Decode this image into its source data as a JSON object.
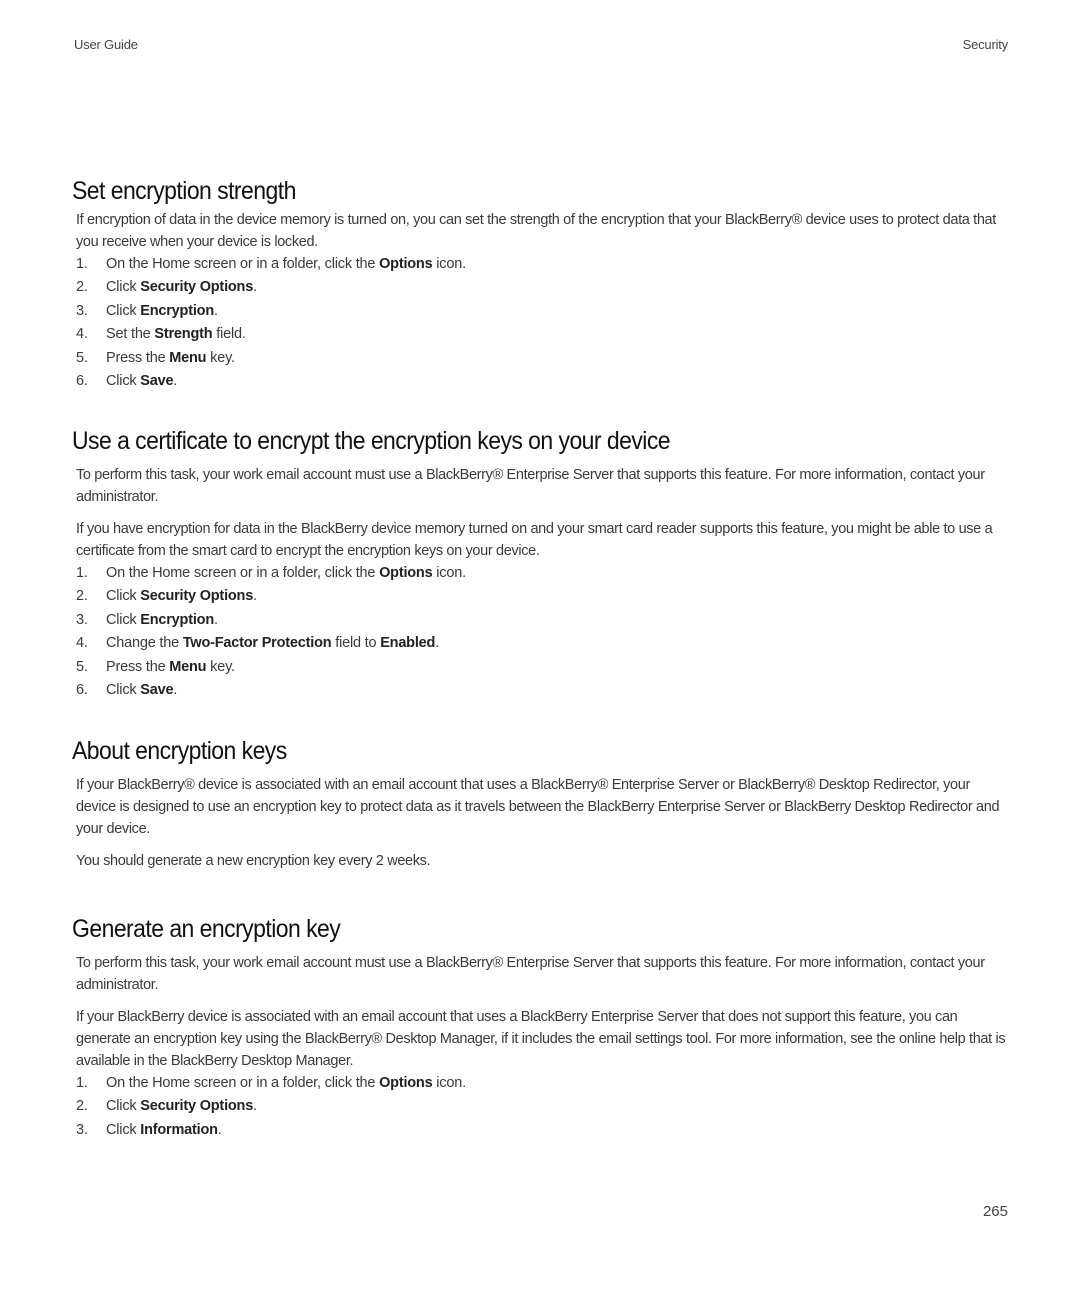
{
  "header": {
    "left": "User Guide",
    "right": "Security"
  },
  "sections": [
    {
      "title": "Set encryption strength",
      "paragraphs": [
        "If encryption of data in the device memory is turned on, you can set the strength of the encryption that your BlackBerry® device uses to protect data that you receive when your device is locked."
      ],
      "steps": [
        {
          "num": "1.",
          "parts": [
            [
              "t",
              "On the Home screen or in a folder, click the "
            ],
            [
              "b",
              "Options"
            ],
            [
              "t",
              " icon."
            ]
          ]
        },
        {
          "num": "2.",
          "parts": [
            [
              "t",
              "Click "
            ],
            [
              "b",
              "Security Options"
            ],
            [
              "t",
              "."
            ]
          ]
        },
        {
          "num": "3.",
          "parts": [
            [
              "t",
              "Click "
            ],
            [
              "b",
              "Encryption"
            ],
            [
              "t",
              "."
            ]
          ]
        },
        {
          "num": "4.",
          "parts": [
            [
              "t",
              "Set the "
            ],
            [
              "b",
              "Strength"
            ],
            [
              "t",
              " field."
            ]
          ]
        },
        {
          "num": "5.",
          "parts": [
            [
              "t",
              "Press the "
            ],
            [
              "b",
              "Menu"
            ],
            [
              "t",
              " key."
            ]
          ]
        },
        {
          "num": "6.",
          "parts": [
            [
              "t",
              "Click "
            ],
            [
              "b",
              "Save"
            ],
            [
              "t",
              "."
            ]
          ]
        }
      ]
    },
    {
      "title": "Use a certificate to encrypt the encryption keys on your device",
      "paragraphs": [
        "To perform this task, your work email account must use a BlackBerry® Enterprise Server that supports this feature. For more information, contact your administrator.",
        "If you have encryption for data in the BlackBerry device memory turned on and your smart card reader supports this feature, you might be able to use a certificate from the smart card to encrypt the encryption keys on your device."
      ],
      "steps": [
        {
          "num": "1.",
          "parts": [
            [
              "t",
              "On the Home screen or in a folder, click the "
            ],
            [
              "b",
              "Options"
            ],
            [
              "t",
              " icon."
            ]
          ]
        },
        {
          "num": "2.",
          "parts": [
            [
              "t",
              "Click "
            ],
            [
              "b",
              "Security Options"
            ],
            [
              "t",
              "."
            ]
          ]
        },
        {
          "num": "3.",
          "parts": [
            [
              "t",
              "Click "
            ],
            [
              "b",
              "Encryption"
            ],
            [
              "t",
              "."
            ]
          ]
        },
        {
          "num": "4.",
          "parts": [
            [
              "t",
              "Change the "
            ],
            [
              "b",
              "Two-Factor Protection"
            ],
            [
              "t",
              " field to "
            ],
            [
              "b",
              "Enabled"
            ],
            [
              "t",
              "."
            ]
          ]
        },
        {
          "num": "5.",
          "parts": [
            [
              "t",
              "Press the "
            ],
            [
              "b",
              "Menu"
            ],
            [
              "t",
              " key."
            ]
          ]
        },
        {
          "num": "6.",
          "parts": [
            [
              "t",
              "Click "
            ],
            [
              "b",
              "Save"
            ],
            [
              "t",
              "."
            ]
          ]
        }
      ]
    },
    {
      "title": "About encryption keys",
      "paragraphs": [
        "If your BlackBerry® device is associated with an email account that uses a BlackBerry® Enterprise Server or BlackBerry® Desktop Redirector, your device is designed to use an encryption key to protect data as it travels between the BlackBerry Enterprise Server or BlackBerry Desktop Redirector and your device.",
        "You should generate a new encryption key every 2 weeks."
      ],
      "steps": []
    },
    {
      "title": "Generate an encryption key",
      "paragraphs": [
        "To perform this task, your work email account must use a BlackBerry® Enterprise Server that supports this feature. For more information, contact your administrator.",
        "If your BlackBerry device is associated with an email account that uses a BlackBerry Enterprise Server that does not support this feature, you can generate an encryption key using the BlackBerry® Desktop Manager, if it includes the email settings tool. For more information, see the online help that is available in the BlackBerry Desktop Manager."
      ],
      "steps": [
        {
          "num": "1.",
          "parts": [
            [
              "t",
              "On the Home screen or in a folder, click the "
            ],
            [
              "b",
              "Options"
            ],
            [
              "t",
              " icon."
            ]
          ]
        },
        {
          "num": "2.",
          "parts": [
            [
              "t",
              "Click "
            ],
            [
              "b",
              "Security Options"
            ],
            [
              "t",
              "."
            ]
          ]
        },
        {
          "num": "3.",
          "parts": [
            [
              "t",
              "Click "
            ],
            [
              "b",
              "Information"
            ],
            [
              "t",
              "."
            ]
          ]
        }
      ]
    }
  ],
  "footer": {
    "page_number": "265"
  }
}
